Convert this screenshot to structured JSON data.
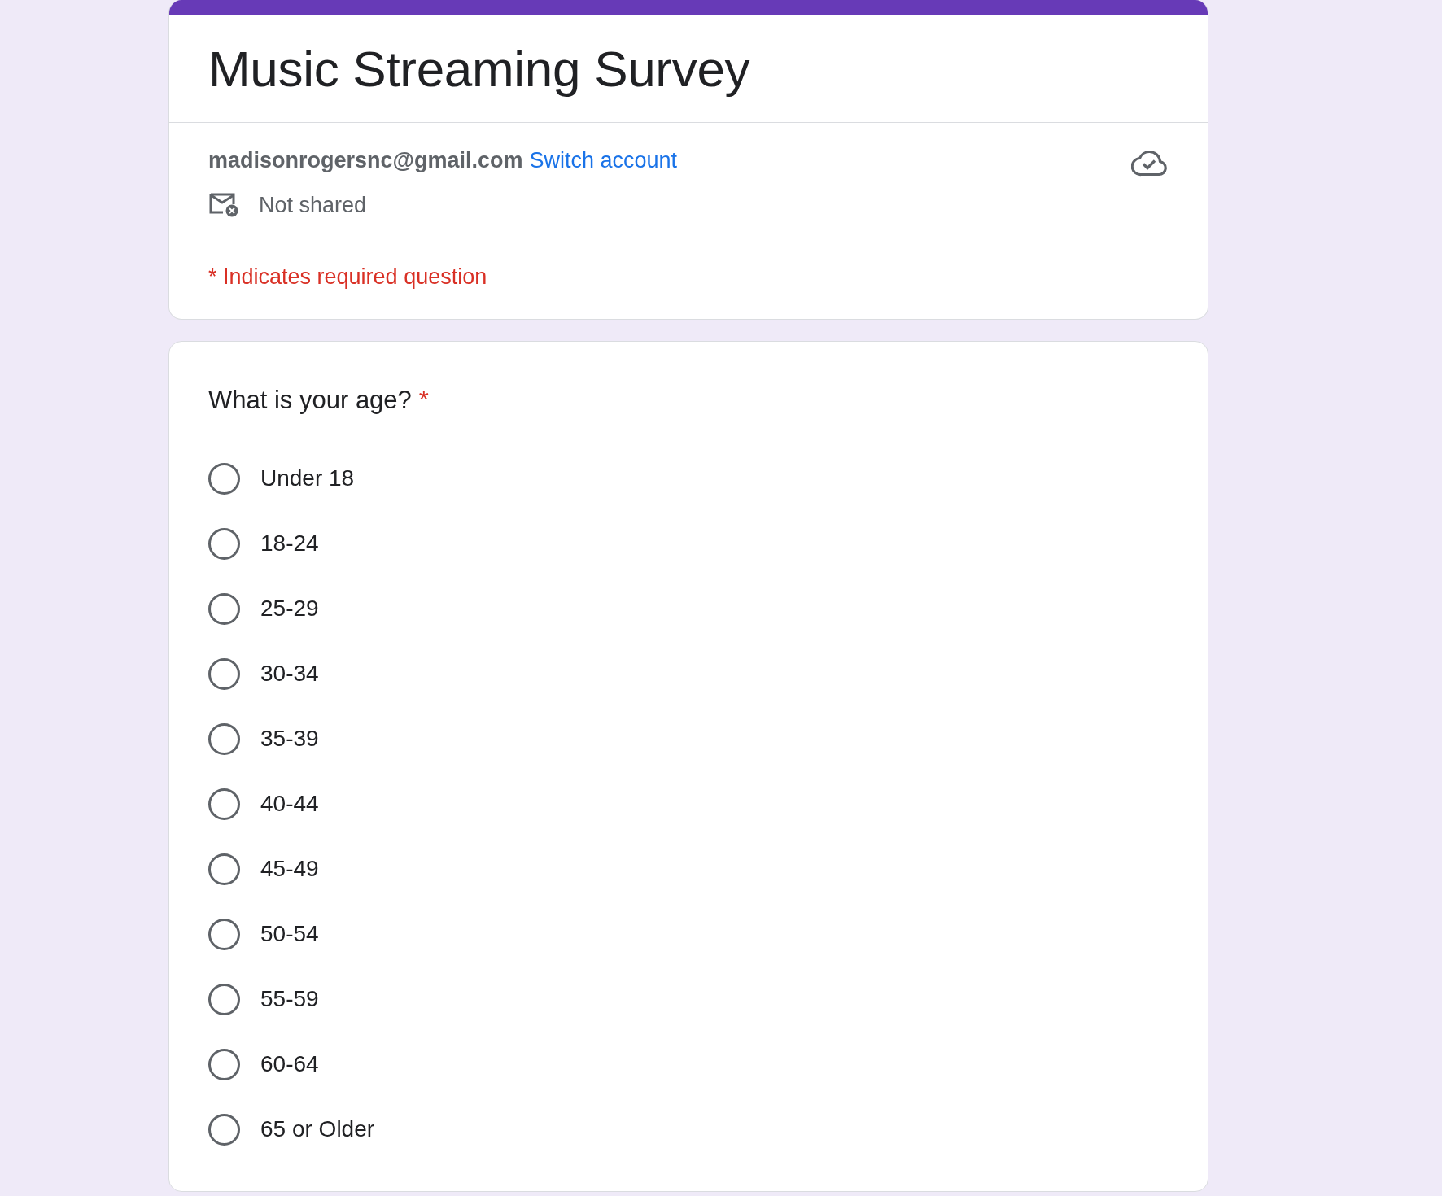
{
  "form": {
    "title": "Music Streaming Survey",
    "account": {
      "email": "madisonrogersnc@gmail.com",
      "switch_link": "Switch account",
      "sharing": "Not shared"
    },
    "required_note": "* Indicates required question"
  },
  "questions": [
    {
      "text": "What is your age?",
      "required": true,
      "required_mark": "*",
      "options": [
        {
          "label": "Under 18",
          "selected": false
        },
        {
          "label": "18-24",
          "selected": false
        },
        {
          "label": "25-29",
          "selected": false
        },
        {
          "label": "30-34",
          "selected": false
        },
        {
          "label": "35-39",
          "selected": false
        },
        {
          "label": "40-44",
          "selected": false
        },
        {
          "label": "45-49",
          "selected": false
        },
        {
          "label": "50-54",
          "selected": false
        },
        {
          "label": "55-59",
          "selected": false
        },
        {
          "label": "60-64",
          "selected": false
        },
        {
          "label": "65 or Older",
          "selected": false
        }
      ]
    }
  ]
}
